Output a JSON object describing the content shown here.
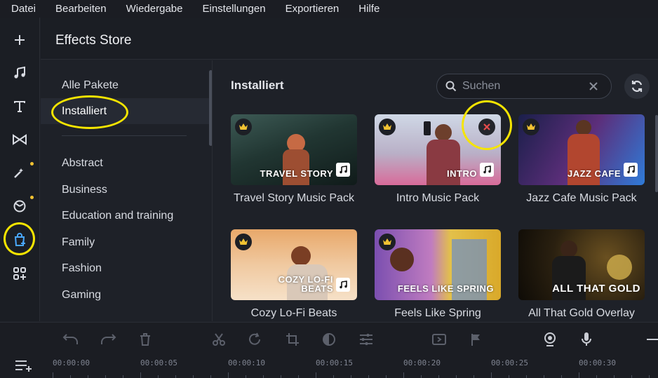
{
  "menu": [
    "Datei",
    "Bearbeiten",
    "Wiedergabe",
    "Einstellungen",
    "Exportieren",
    "Hilfe"
  ],
  "header": {
    "title": "Effects Store"
  },
  "categories": {
    "top": [
      "Alle Pakete",
      "Installiert"
    ],
    "list": [
      "Abstract",
      "Business",
      "Education and training",
      "Family",
      "Fashion",
      "Gaming"
    ],
    "selected": "Installiert"
  },
  "content": {
    "section_title": "Installiert",
    "search": {
      "placeholder": "Suchen"
    },
    "cards": [
      {
        "name": "Travel Story Music Pack",
        "overlay": "TRAVEL STORY",
        "icon": "music-icon",
        "crown": true
      },
      {
        "name": "Intro Music Pack",
        "overlay": "INTRO",
        "icon": "music-icon",
        "crown": true,
        "remove": true
      },
      {
        "name": "Jazz Cafe Music Pack",
        "overlay": "JAZZ CAFE",
        "icon": "music-icon",
        "crown": true
      },
      {
        "name": "Cozy Lo-Fi Beats",
        "overlay": "COZY LO-FI BEATS",
        "icon": "music-icon",
        "crown": true
      },
      {
        "name": "Feels Like Spring",
        "overlay": "FEELS LIKE SPRING",
        "crown": true
      },
      {
        "name": "All That Gold Overlay",
        "overlay": "ALL THAT GOLD",
        "crown": false
      }
    ]
  },
  "timeline": {
    "labels": [
      "00:00:00",
      "00:00:05",
      "00:00:10",
      "00:00:15",
      "00:00:20",
      "00:00:25",
      "00:00:30"
    ]
  },
  "colors": {
    "accent_highlight": "#f5e400",
    "crown": "#f1c232",
    "remove": "#e54b4b",
    "background": "#1e2128"
  }
}
